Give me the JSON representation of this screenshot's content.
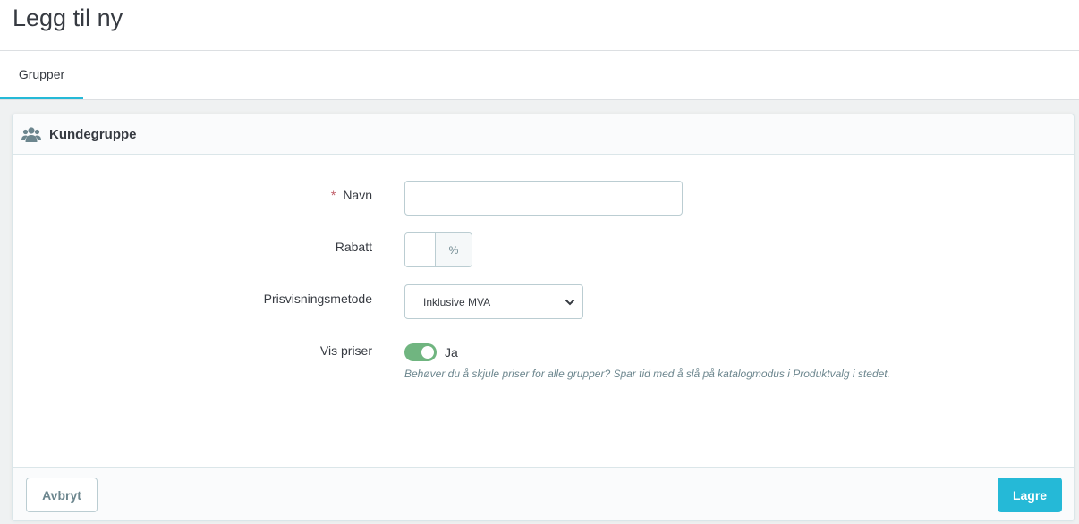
{
  "header": {
    "title": "Legg til ny"
  },
  "tabs": [
    {
      "label": "Grupper"
    }
  ],
  "card": {
    "title": "Kundegruppe",
    "icon": "users-icon",
    "fields": {
      "name": {
        "label": "Navn",
        "required_marker": "*",
        "value": ""
      },
      "discount": {
        "label": "Rabatt",
        "value": "",
        "unit": "%"
      },
      "price_display": {
        "label": "Prisvisningsmetode",
        "selected": "Inklusive MVA"
      },
      "show_prices": {
        "label": "Vis priser",
        "state_label": "Ja",
        "enabled": true,
        "help": "Behøver du å skjule priser for alle grupper? Spar tid med å slå på katalogmodus i Produktvalg i stedet."
      }
    },
    "footer": {
      "cancel_label": "Avbryt",
      "save_label": "Lagre"
    }
  },
  "colors": {
    "accent": "#25b9d7",
    "toggle_on": "#70b580",
    "required": "#c05c67"
  }
}
